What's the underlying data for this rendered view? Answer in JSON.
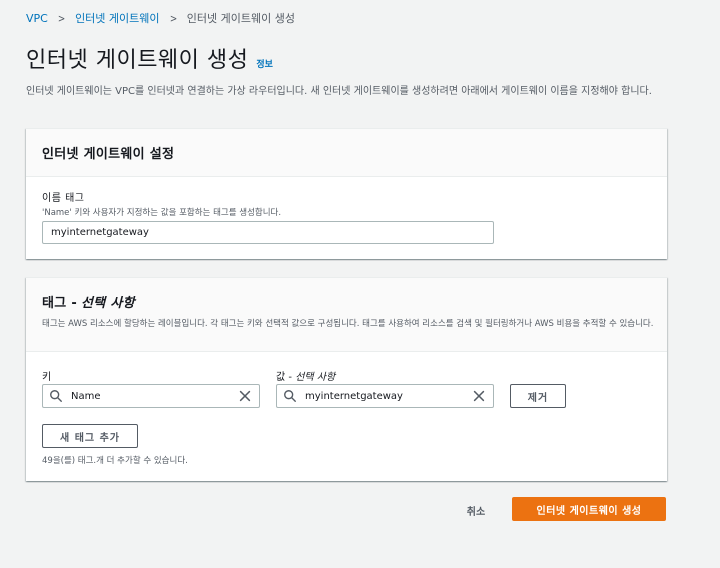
{
  "breadcrumb": {
    "items": [
      "VPC",
      "인터넷 게이트웨이"
    ],
    "current": "인터넷 게이트웨이 생성",
    "separator": ">"
  },
  "page": {
    "title": "인터넷 게이트웨이 생성",
    "info_link": "정보",
    "description": "인터넷 게이트웨이는 VPC를 인터넷과 연결하는 가상 라우터입니다. 새 인터넷 게이트웨이를 생성하려면 아래에서 게이트웨이 이름을 지정해야 합니다."
  },
  "settings_panel": {
    "title": "인터넷 게이트웨이 설정",
    "name_tag": {
      "label": "이름 태그",
      "description": "'Name' 키와 사용자가 지정하는 값을 포함하는 태그를 생성합니다.",
      "value": "myinternetgateway"
    }
  },
  "tags_panel": {
    "title": "태그 -",
    "title_optional": "선택 사항",
    "description": "태그는 AWS 리소스에 할당하는 레이블입니다. 각 태그는 키와 선택적 값으로 구성됩니다. 태그를 사용하여 리소스를 검색 및 필터링하거나 AWS 비용을 추적할 수 있습니다.",
    "key_label": "키",
    "value_label_prefix": "값 -",
    "value_label_optional": "선택 사항",
    "key_value": "Name",
    "value_value": "myinternetgateway",
    "remove_button": "제거",
    "add_tag_button": "새 태그 추가",
    "tag_limit_text": "49을(를) 태그.개 더 추가할 수 있습니다."
  },
  "footer": {
    "cancel_label": "취소",
    "create_label": "인터넷 게이트웨이 생성"
  },
  "colors": {
    "link": "#0073bb",
    "primary": "#ec7211",
    "background": "#f2f3f3"
  },
  "icons": [
    "search-icon",
    "clear-icon",
    "chevron-right-icon"
  ]
}
